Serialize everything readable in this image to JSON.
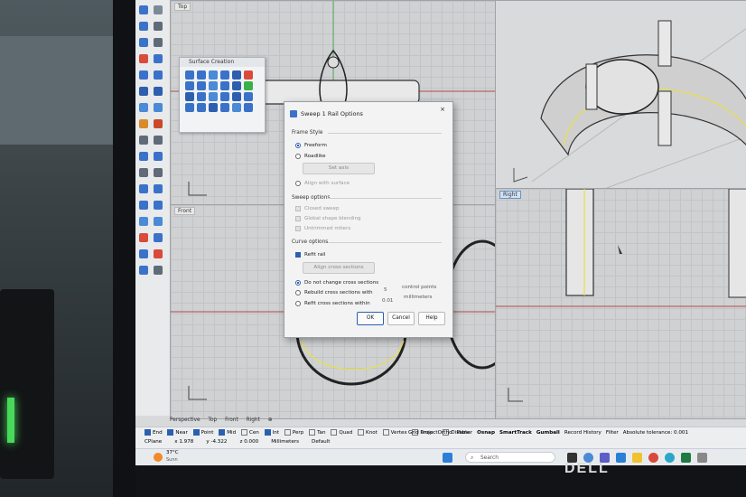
{
  "viewports": [
    {
      "label": "Top",
      "active": false
    },
    {
      "label": "Front",
      "active": false
    },
    {
      "label": "Right",
      "active": true
    },
    {
      "label": "Perspective",
      "active": false
    }
  ],
  "panel": {
    "title": "Surface Creation"
  },
  "dialog": {
    "title": "Sweep 1 Rail Options",
    "close": "×",
    "frame_style": {
      "heading": "Frame Style",
      "freeform": "Freeform",
      "roadlike": "Roadlike",
      "set_axis": "Set axis",
      "align_surface": "Align with surface"
    },
    "sweep_options": {
      "heading": "Sweep options",
      "closed": "Closed sweep",
      "global_blend": "Global shape blending",
      "untrimmed": "Untrimmed miters"
    },
    "curve_options": {
      "heading": "Curve options",
      "refit_rail": "Refit rail",
      "align_cross": "Align cross sections",
      "no_change": "Do not change cross sections",
      "rebuild": "Rebuild cross sections with",
      "rebuild_value": "5",
      "rebuild_unit": "control points",
      "refit": "Refit cross sections within",
      "refit_value": "0.01",
      "refit_unit": "millimeters"
    },
    "buttons": {
      "ok": "OK",
      "cancel": "Cancel",
      "help": "Help"
    }
  },
  "tabs": [
    "Perspective",
    "Top",
    "Front",
    "Right",
    "⊕"
  ],
  "snaps": [
    {
      "label": "End",
      "on": true
    },
    {
      "label": "Near",
      "on": true
    },
    {
      "label": "Point",
      "on": true
    },
    {
      "label": "Mid",
      "on": true
    },
    {
      "label": "Cen",
      "on": false
    },
    {
      "label": "Int",
      "on": true
    },
    {
      "label": "Perp",
      "on": false
    },
    {
      "label": "Tan",
      "on": false
    },
    {
      "label": "Quad",
      "on": false
    },
    {
      "label": "Knot",
      "on": false
    },
    {
      "label": "Vertex",
      "on": false
    },
    {
      "label": "Project",
      "on": false
    },
    {
      "label": "Disable",
      "on": false
    }
  ],
  "status": {
    "cplane": "CPlane",
    "x": "x 1.978",
    "y": "y -4.322",
    "z": "z 0.000",
    "units": "Millimeters",
    "layer": "Default",
    "toggles": [
      "Grid Snap",
      "Ortho",
      "Planar",
      "Osnap",
      "SmartTrack",
      "Gumball",
      "Record History",
      "Filter"
    ],
    "tolerance": "Absolute tolerance: 0.001"
  },
  "taskbar": {
    "weather_temp": "37°C",
    "weather_desc": "Sunn",
    "search_placeholder": "Search"
  },
  "brand": "DELL",
  "colors": {
    "accent": "#2b5fb0",
    "viewport_bg": "#cfd1d3",
    "rail_yellow": "#e8e04a"
  }
}
